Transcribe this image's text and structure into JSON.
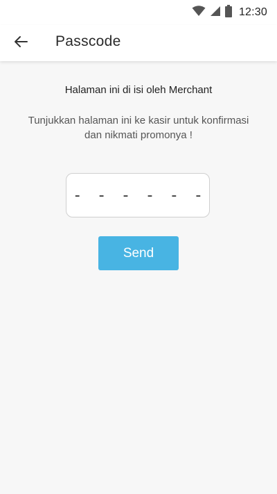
{
  "status_bar": {
    "time": "12:30",
    "icons": [
      "wifi-icon",
      "cell-signal-icon",
      "battery-icon"
    ]
  },
  "app_bar": {
    "back_icon": "arrow-left-icon",
    "title": "Passcode"
  },
  "main": {
    "heading": "Halaman ini di isi oleh Merchant",
    "instruction": "Tunjukkan halaman ini ke kasir untuk konfirmasi dan nikmati promonya !",
    "passcode_display": "------",
    "send_label": "Send"
  },
  "colors": {
    "accent": "#48b4e3",
    "background": "#f7f7f7",
    "bar_background": "#ffffff"
  }
}
